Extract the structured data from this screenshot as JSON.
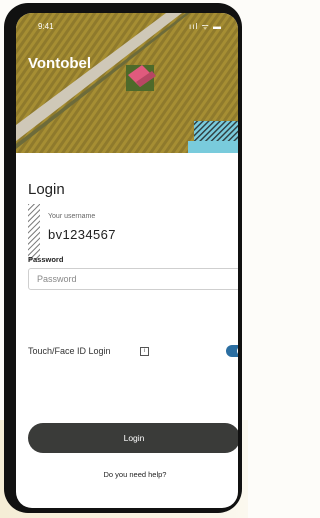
{
  "status_bar": {
    "time": "9:41",
    "icons": "ııl ᯤ ▬"
  },
  "brand": {
    "name": "Vontobel"
  },
  "form": {
    "title": "Login",
    "username_label": "Your username",
    "username_value": "bv1234567",
    "password_label": "Password",
    "password_placeholder": "Password",
    "touch_label": "Touch/Face ID Login",
    "touch_toggle_on": true
  },
  "actions": {
    "login_button": "Login",
    "help_link": "Do you need help?"
  },
  "colors": {
    "accent": "#2b6ea1",
    "button": "#3a3b39",
    "hero_teal": "#79cbdc"
  }
}
